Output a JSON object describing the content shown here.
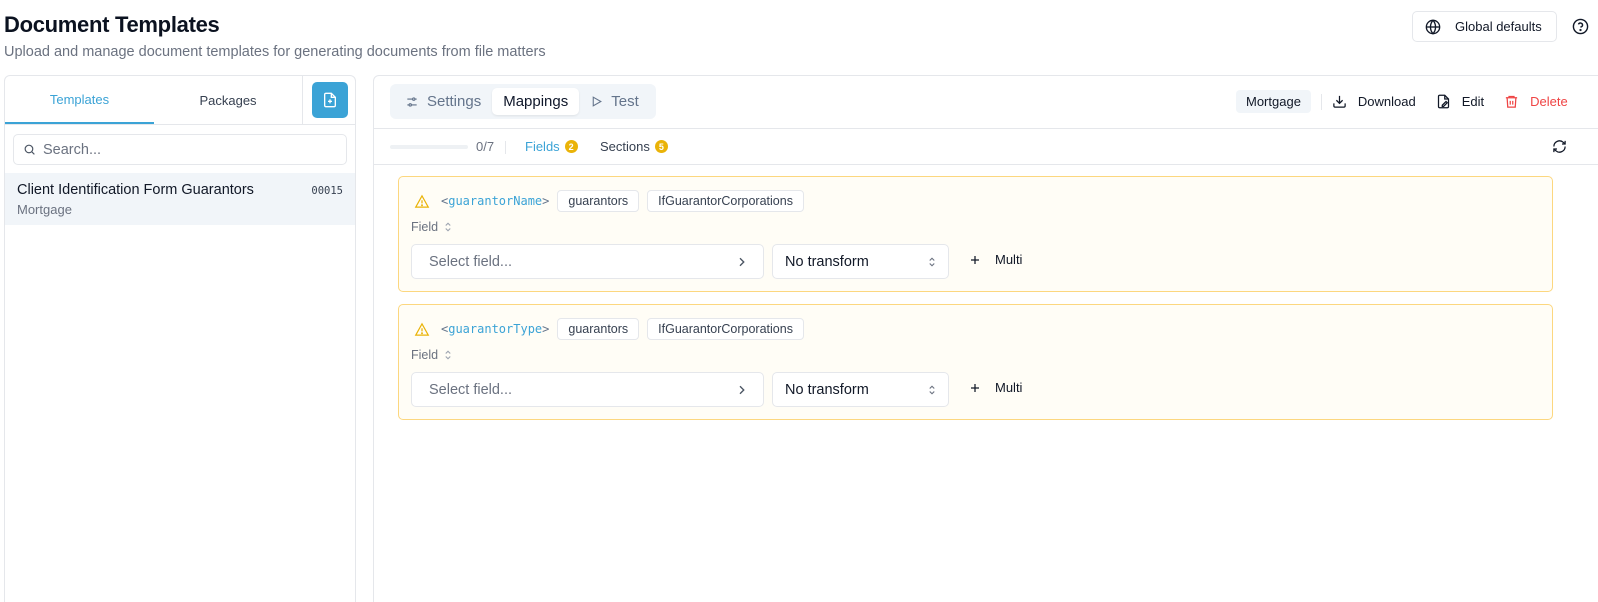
{
  "page": {
    "title": "Document Templates",
    "subtitle": "Upload and manage document templates for generating documents from file matters",
    "global_defaults_label": "Global defaults"
  },
  "left": {
    "tabs": [
      {
        "label": "Templates",
        "active": true
      },
      {
        "label": "Packages",
        "active": false
      }
    ],
    "search_placeholder": "Search...",
    "templates": [
      {
        "name": "Client Identification Form Guarantors",
        "category": "Mortgage",
        "code": "00015"
      }
    ]
  },
  "right": {
    "view_tabs": [
      {
        "label": "Settings",
        "icon": "sliders-icon",
        "active": false
      },
      {
        "label": "Mappings",
        "icon": "",
        "active": true
      },
      {
        "label": "Test",
        "icon": "play-icon",
        "active": false
      }
    ],
    "category_tag": "Mortgage",
    "actions": {
      "download": "Download",
      "edit": "Edit",
      "delete": "Delete"
    },
    "progress": {
      "text": "0/7",
      "fraction": 0.0
    },
    "subtabs": {
      "fields_label": "Fields",
      "fields_count": "2",
      "sections_label": "Sections",
      "sections_count": "5"
    },
    "mappings": [
      {
        "open": "<",
        "variable": "guarantorName",
        "close": ">",
        "chips": [
          "guarantors",
          "IfGuarantorCorporations"
        ],
        "field_label": "Field",
        "field_placeholder": "Select field...",
        "transform": "No transform",
        "multi_label": "Multi"
      },
      {
        "open": "<",
        "variable": "guarantorType",
        "close": ">",
        "chips": [
          "guarantors",
          "IfGuarantorCorporations"
        ],
        "field_label": "Field",
        "field_placeholder": "Select field...",
        "transform": "No transform",
        "multi_label": "Multi"
      }
    ]
  },
  "colors": {
    "accent": "#3ba3d6",
    "warning": "#eab308",
    "danger": "#ef4444",
    "card_border": "#fcd77f",
    "card_bg": "#fffdf6"
  }
}
